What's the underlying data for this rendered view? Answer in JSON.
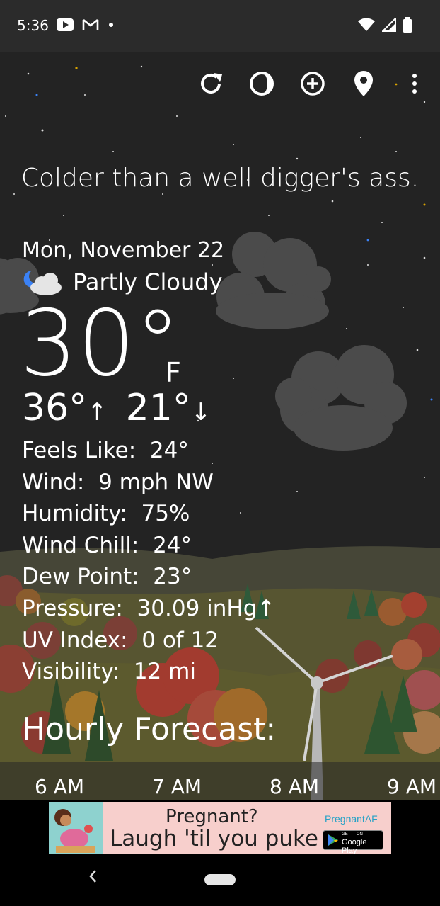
{
  "status_bar": {
    "time": "5:36",
    "left_icons": [
      "youtube-icon",
      "gmail-icon",
      "dot-icon"
    ],
    "right_icons": [
      "wifi-icon",
      "signal-icon",
      "battery-icon"
    ]
  },
  "toolbar": {
    "icons": [
      "refresh-icon",
      "theme-icon",
      "add-location-icon",
      "location-pin-icon",
      "more-vert-icon"
    ]
  },
  "weather": {
    "tagline": "Colder than a well digger's ass.",
    "date": "Mon, November 22",
    "condition": "Partly Cloudy",
    "condition_icon": "partly-cloudy-night-icon",
    "temperature": "30°",
    "unit": "F",
    "high": "36°",
    "low": "21°",
    "high_arrow": "↑",
    "low_arrow": "↓",
    "details": [
      {
        "label": "Feels Like:",
        "value": "24°"
      },
      {
        "label": "Wind:",
        "value": "9 mph NW"
      },
      {
        "label": "Humidity:",
        "value": "75%"
      },
      {
        "label": "Wind Chill:",
        "value": "24°"
      },
      {
        "label": "Dew Point:",
        "value": "23°"
      },
      {
        "label": "Pressure:",
        "value": "30.09 inHg↑"
      },
      {
        "label": "UV Index:",
        "value": "0 of 12"
      },
      {
        "label": "Visibility:",
        "value": "12 mi"
      }
    ]
  },
  "hourly": {
    "title": "Hourly Forecast:",
    "hours": [
      "6 AM",
      "7 AM",
      "8 AM",
      "9 AM"
    ]
  },
  "ad": {
    "title": "Pregnant?",
    "subtitle": "Laugh 'til you puke",
    "brand": "PregnantAF",
    "store_small": "GET IT ON",
    "store_label": "Google Play"
  },
  "colors": {
    "sky": "#232323",
    "hills": "#5b5a2c",
    "tree_autumn": "#9e4a3a"
  }
}
